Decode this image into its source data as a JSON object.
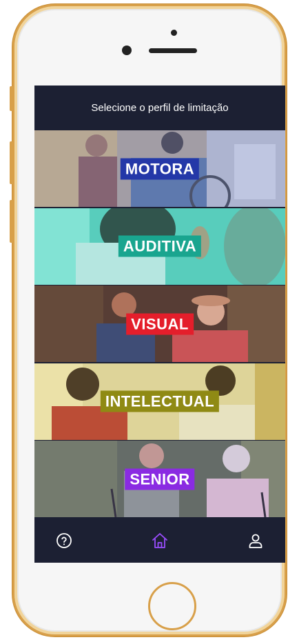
{
  "header": {
    "title": "Selecione o perfil de limitação"
  },
  "profiles": [
    {
      "label": "MOTORA",
      "label_color": "#2438a8",
      "tint": "#7c8fd8"
    },
    {
      "label": "AUDITIVA",
      "label_color": "#19a58f",
      "tint": "#3fd7c4"
    },
    {
      "label": "VISUAL",
      "label_color": "#e41e2b",
      "tint": "#a34a4a"
    },
    {
      "label": "INTELECTUAL",
      "label_color": "#8f8a14",
      "tint": "#d8cf6a"
    },
    {
      "label": "SENIOR",
      "label_color": "#8a2be2",
      "tint": "#8a7ad0"
    }
  ],
  "navbar": {
    "items": [
      {
        "icon": "help-icon"
      },
      {
        "icon": "home-icon",
        "color": "#9b4dff"
      },
      {
        "icon": "user-icon"
      }
    ]
  }
}
